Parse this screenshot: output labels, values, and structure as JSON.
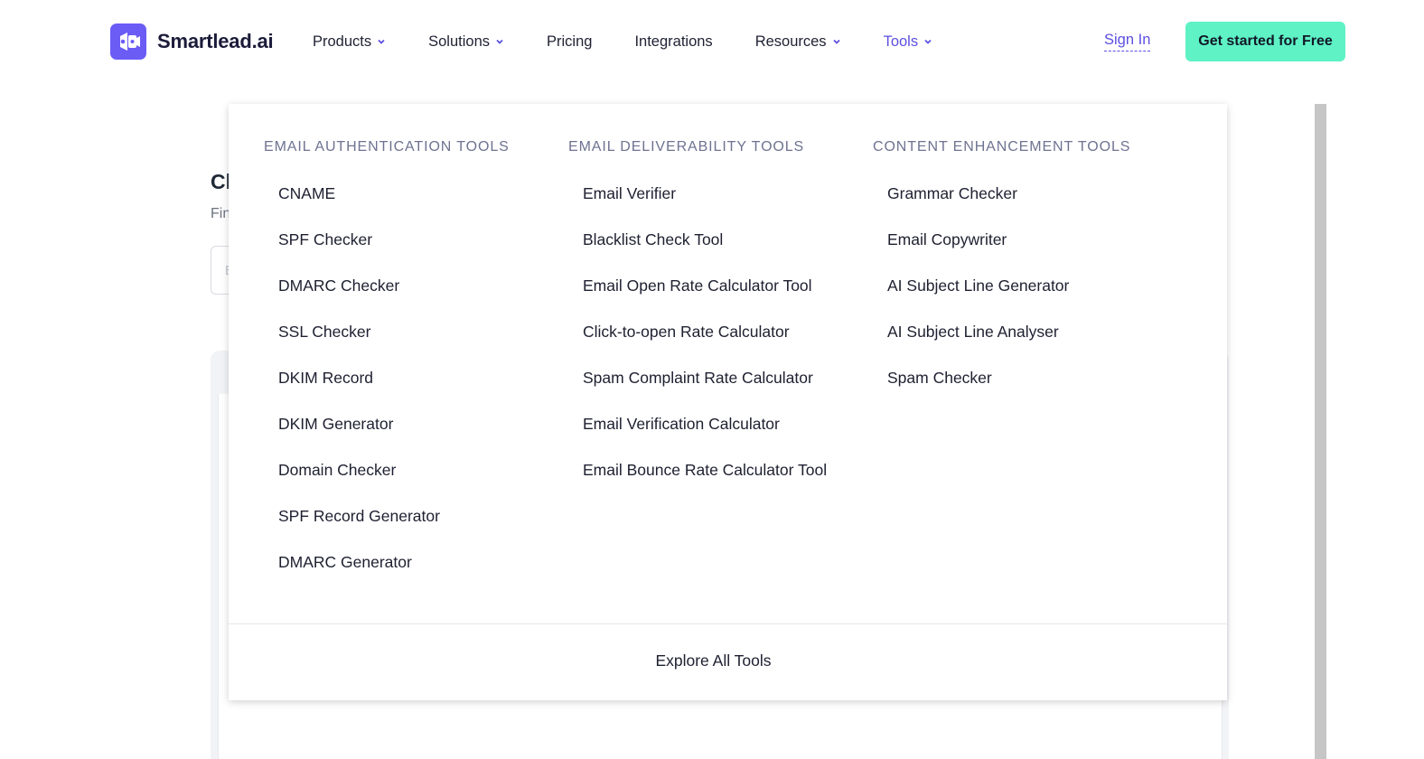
{
  "brand": {
    "name": "Smartlead.ai",
    "logo_color": "#6b5cf6"
  },
  "nav": {
    "items": [
      {
        "label": "Products",
        "has_dropdown": true,
        "active": false
      },
      {
        "label": "Solutions",
        "has_dropdown": true,
        "active": false
      },
      {
        "label": "Pricing",
        "has_dropdown": false,
        "active": false
      },
      {
        "label": "Integrations",
        "has_dropdown": false,
        "active": false
      },
      {
        "label": "Resources",
        "has_dropdown": true,
        "active": false
      },
      {
        "label": "Tools",
        "has_dropdown": true,
        "active": true
      }
    ],
    "sign_in": "Sign In",
    "cta": "Get started for Free",
    "accent_color": "#5b4fe0",
    "cta_color": "#5ef2c5"
  },
  "background_page": {
    "heading_fragment": "Cl",
    "subtitle_fragment": "Fin",
    "input_placeholder_fragment": "E"
  },
  "tools_menu": {
    "columns": [
      {
        "title": "EMAIL AUTHENTICATION TOOLS",
        "items": [
          "CNAME",
          "SPF Checker",
          "DMARC Checker",
          "SSL Checker",
          "DKIM Record",
          "DKIM Generator",
          "Domain Checker",
          "SPF Record Generator",
          "DMARC Generator"
        ]
      },
      {
        "title": "EMAIL DELIVERABILITY TOOLS",
        "items": [
          "Email Verifier",
          "Blacklist Check Tool",
          "Email Open Rate Calculator Tool",
          "Click-to-open Rate Calculator",
          "Spam Complaint Rate Calculator",
          "Email Verification Calculator",
          "Email Bounce Rate Calculator Tool"
        ]
      },
      {
        "title": "CONTENT ENHANCEMENT TOOLS",
        "items": [
          "Grammar Checker",
          "Email Copywriter",
          "AI Subject Line Generator",
          "AI Subject Line Analyser",
          "Spam Checker"
        ]
      }
    ],
    "footer_link": "Explore All Tools"
  }
}
